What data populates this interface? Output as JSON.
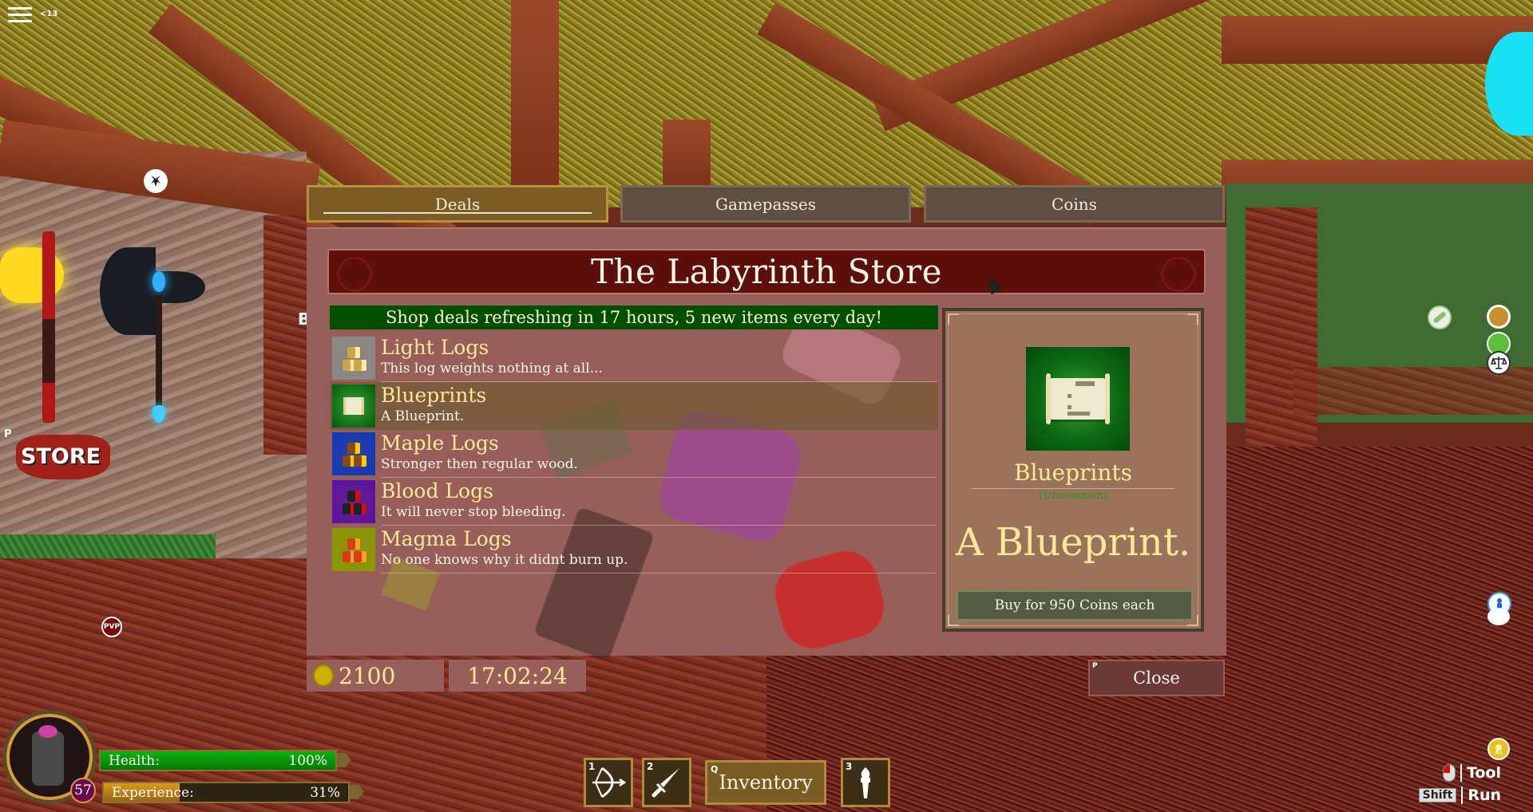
{
  "hud": {
    "chat_count": "<13",
    "level": "57",
    "health": {
      "label": "Health:",
      "value_text": "100%",
      "fraction": 1.0
    },
    "experience": {
      "label": "Experience:",
      "value_text": "31%",
      "fraction": 0.31
    },
    "hotbar": [
      {
        "key": "1",
        "icon": "bow-icon"
      },
      {
        "key": "2",
        "icon": "sword-icon"
      },
      {
        "key": "3",
        "icon": "torch-icon"
      }
    ],
    "inventory": {
      "key": "Q",
      "label": "Inventory"
    },
    "controls": [
      {
        "key_icon": "mouse-icon",
        "label": "Tool"
      },
      {
        "key": "Shift",
        "label": "Run"
      }
    ],
    "world_store_sign": {
      "key": "P",
      "label": "STORE"
    },
    "pvp_label": "PVP",
    "partial_text": "B"
  },
  "store": {
    "tabs": [
      {
        "label": "Deals",
        "active": true
      },
      {
        "label": "Gamepasses",
        "active": false
      },
      {
        "label": "Coins",
        "active": false
      }
    ],
    "title": "The Labyrinth Store",
    "deals_banner": "Shop deals refreshing in 17 hours, 5 new items every day!",
    "items": [
      {
        "name": "Light Logs",
        "description": "This log weights nothing at all...",
        "icon": "light-logs-icon",
        "icon_bg": "#8a8a8a",
        "log_color": "#c8a84a",
        "end_color": "#ffeaa0",
        "selected": false
      },
      {
        "name": "Blueprints",
        "description": "A Blueprint.",
        "icon": "blueprint-scroll-icon",
        "icon_bg": "#0d6a13",
        "selected": true
      },
      {
        "name": "Maple Logs",
        "description": "Stronger then regular wood.",
        "icon": "maple-logs-icon",
        "icon_bg": "#1038b8",
        "log_color": "#8a4a10",
        "end_color": "#ffcc00",
        "selected": false
      },
      {
        "name": "Blood Logs",
        "description": "It will never stop bleeding.",
        "icon": "blood-logs-icon",
        "icon_bg": "#5a10a0",
        "log_color": "#222222",
        "end_color": "#d01010",
        "selected": false
      },
      {
        "name": "Magma Logs",
        "description": "No one knows why it didnt burn up.",
        "icon": "magma-logs-icon",
        "icon_bg": "#8a9a00",
        "log_color": "#d83a1a",
        "end_color": "#ffa020",
        "selected": false
      }
    ],
    "detail": {
      "name": "Blueprints",
      "rarity": "[Uncommon]",
      "rarity_color": "#1f9a1f",
      "description": "A Blueprint.",
      "buy_label": "Buy for 950 Coins each"
    },
    "coins": "2100",
    "timer": "17:02:24",
    "close": {
      "key": "P",
      "label": "Close"
    }
  }
}
